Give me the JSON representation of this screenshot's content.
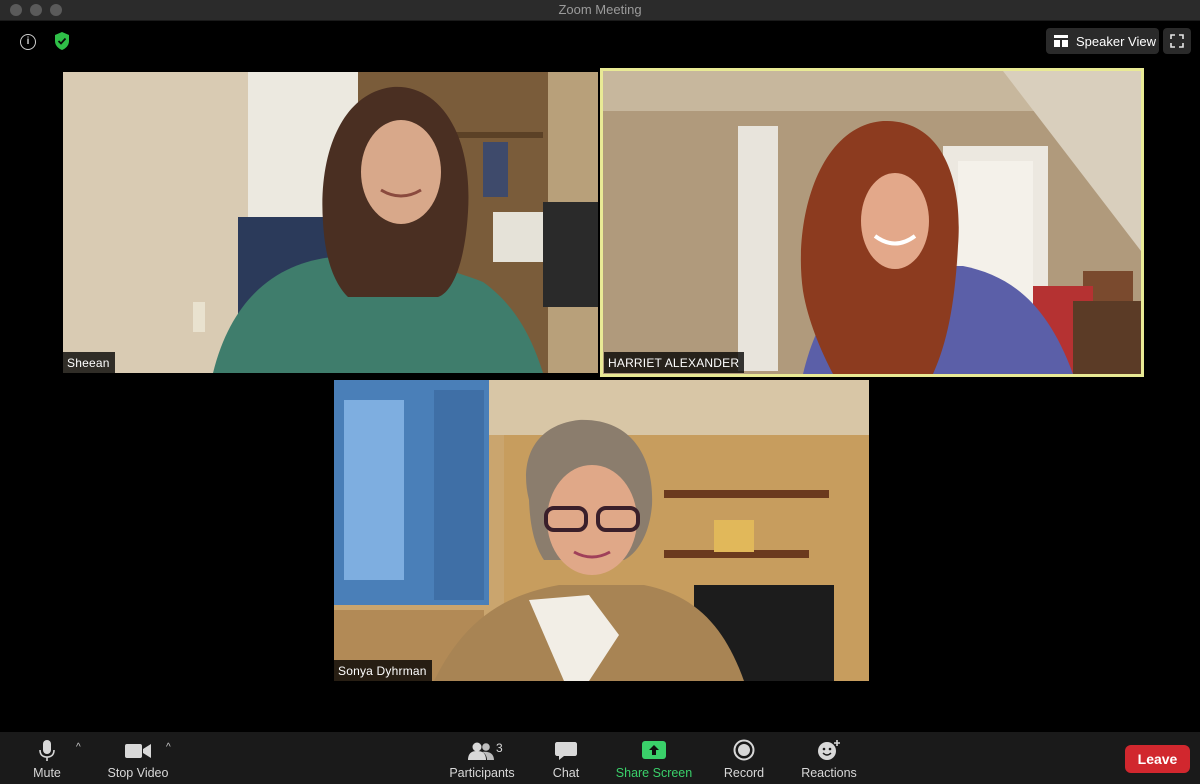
{
  "window": {
    "title": "Zoom Meeting"
  },
  "top_controls": {
    "speaker_view_label": "Speaker View"
  },
  "participants": [
    {
      "name": "Sheean"
    },
    {
      "name": "HARRIET ALEXANDER",
      "active_speaker": true
    },
    {
      "name": "Sonya Dyhrman"
    }
  ],
  "toolbar": {
    "mute_label": "Mute",
    "stop_video_label": "Stop Video",
    "participants_label": "Participants",
    "participants_count": "3",
    "chat_label": "Chat",
    "share_screen_label": "Share Screen",
    "record_label": "Record",
    "reactions_label": "Reactions",
    "leave_label": "Leave"
  },
  "colors": {
    "active_speaker_border": "#e9ea95",
    "share_green": "#3ad06a",
    "leave_red": "#d1272e",
    "shield_green": "#2fbf48"
  }
}
